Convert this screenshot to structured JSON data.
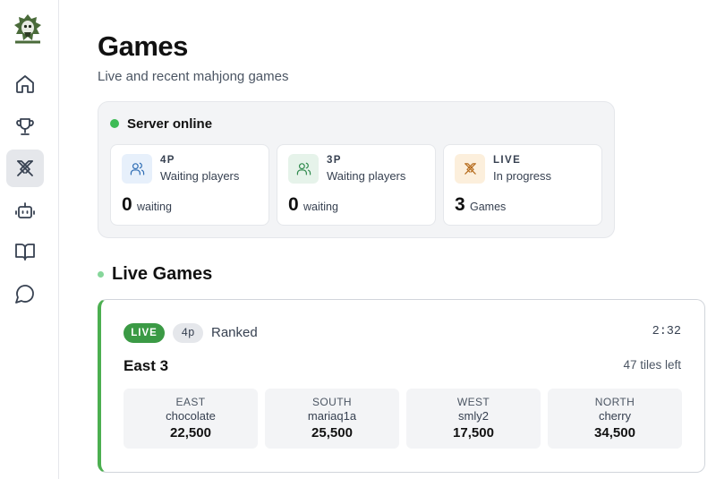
{
  "colors": {
    "online": "#3dbb55",
    "live_badge": "#3b9a45",
    "accent_green": "#4caf50",
    "icon_4p_bg": "#e7f0fb",
    "icon_4p_stroke": "#2e6db4",
    "icon_3p_bg": "#e6f3ea",
    "icon_3p_stroke": "#2f8a4d",
    "icon_live_bg": "#fcefdc",
    "icon_live_stroke": "#b56a1a"
  },
  "sidebar": {
    "items": [
      {
        "name": "home",
        "icon": "home-icon"
      },
      {
        "name": "leaderboard",
        "icon": "trophy-icon"
      },
      {
        "name": "games",
        "icon": "crossed-swords-icon",
        "active": true
      },
      {
        "name": "bots",
        "icon": "robot-icon"
      },
      {
        "name": "docs",
        "icon": "book-icon"
      },
      {
        "name": "chat",
        "icon": "chat-bubble-icon"
      }
    ]
  },
  "header": {
    "title": "Games",
    "subtitle": "Live and recent mahjong games"
  },
  "server": {
    "status": "Server online",
    "stats": [
      {
        "tag": "4P",
        "desc": "Waiting players",
        "value": "0",
        "unit": "waiting",
        "icon": "users-icon"
      },
      {
        "tag": "3P",
        "desc": "Waiting players",
        "value": "0",
        "unit": "waiting",
        "icon": "users-icon"
      },
      {
        "tag": "LIVE",
        "desc": "In progress",
        "value": "3",
        "unit": "Games",
        "icon": "crossed-swords-icon"
      }
    ]
  },
  "live_section": {
    "title": "Live Games"
  },
  "game": {
    "badge": "LIVE",
    "mode": "4p",
    "type": "Ranked",
    "timer": "2:32",
    "round": "East 3",
    "tiles_left": "47 tiles left",
    "seats": [
      {
        "wind": "EAST",
        "player": "chocolate",
        "score": "22,500"
      },
      {
        "wind": "SOUTH",
        "player": "mariaq1a",
        "score": "25,500"
      },
      {
        "wind": "WEST",
        "player": "smly2",
        "score": "17,500"
      },
      {
        "wind": "NORTH",
        "player": "cherry",
        "score": "34,500"
      }
    ]
  }
}
